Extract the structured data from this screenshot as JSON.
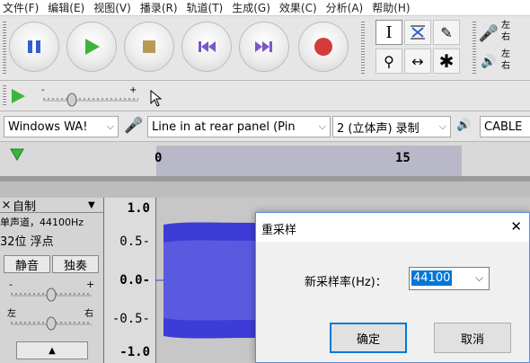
{
  "menu": [
    "文件(F)",
    "编辑(E)",
    "视图(V)",
    "播录(R)",
    "轨道(T)",
    "生成(G)",
    "效果(C)",
    "分析(A)",
    "帮助(H)"
  ],
  "meters": {
    "record_top": "左",
    "record_bottom": "右",
    "play_top": "左",
    "play_bottom": "右"
  },
  "devices": {
    "host": "Windows WA!",
    "input": "Line in at rear panel (Pin",
    "channels": "2 (立体声) 录制",
    "output": "CABLE"
  },
  "timeline": {
    "tick_0": "0",
    "tick_15": "15"
  },
  "track": {
    "name": "自制",
    "close": "×",
    "info_line1": "单声道，44100Hz",
    "info_line2": "32位 浮点",
    "mute": "静音",
    "solo": "独奏",
    "gain_minus": "-",
    "gain_plus": "+",
    "pan_left": "左",
    "pan_right": "右",
    "collapse": "▲"
  },
  "ruler": [
    "1.0",
    "0.5-",
    "0.0-",
    "-0.5-",
    "-1.0"
  ],
  "colors": {
    "wave": "#3c3cd6",
    "wave_light": "#5a5ae0",
    "selection": "#c7c7c7",
    "accent": "#0078d7"
  },
  "dialog": {
    "title": "重采样",
    "close": "✕",
    "rate_label": "新采样率(Hz)：",
    "rate_value": "44100",
    "ok": "确定",
    "cancel": "取消"
  }
}
